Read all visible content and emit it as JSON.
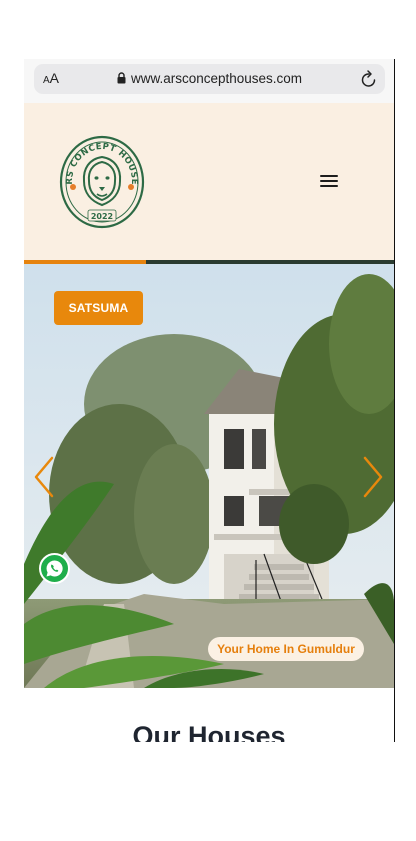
{
  "browser": {
    "text_size_label": "AA",
    "url": "www.arsconcepthouses.com",
    "lock_icon": "lock-icon",
    "reload_icon": "reload-icon"
  },
  "header": {
    "logo": {
      "text_top": "ARS CONCEPT HOUSES",
      "year": "2022",
      "emblem": "lion-icon"
    },
    "menu_icon": "hamburger-menu-icon"
  },
  "slider": {
    "progress_fraction": 0.33,
    "location_badge": "SATSUMA",
    "caption": "Your Home In Gumuldur",
    "prev_icon": "chevron-left-icon",
    "next_icon": "chevron-right-icon"
  },
  "whatsapp_icon": "whatsapp-icon",
  "section": {
    "title": "Our Houses"
  },
  "colors": {
    "accent": "#e8880c",
    "header_bg": "#faefe2",
    "logo_green": "#2d6a45",
    "whatsapp_green": "#1fae4b"
  }
}
